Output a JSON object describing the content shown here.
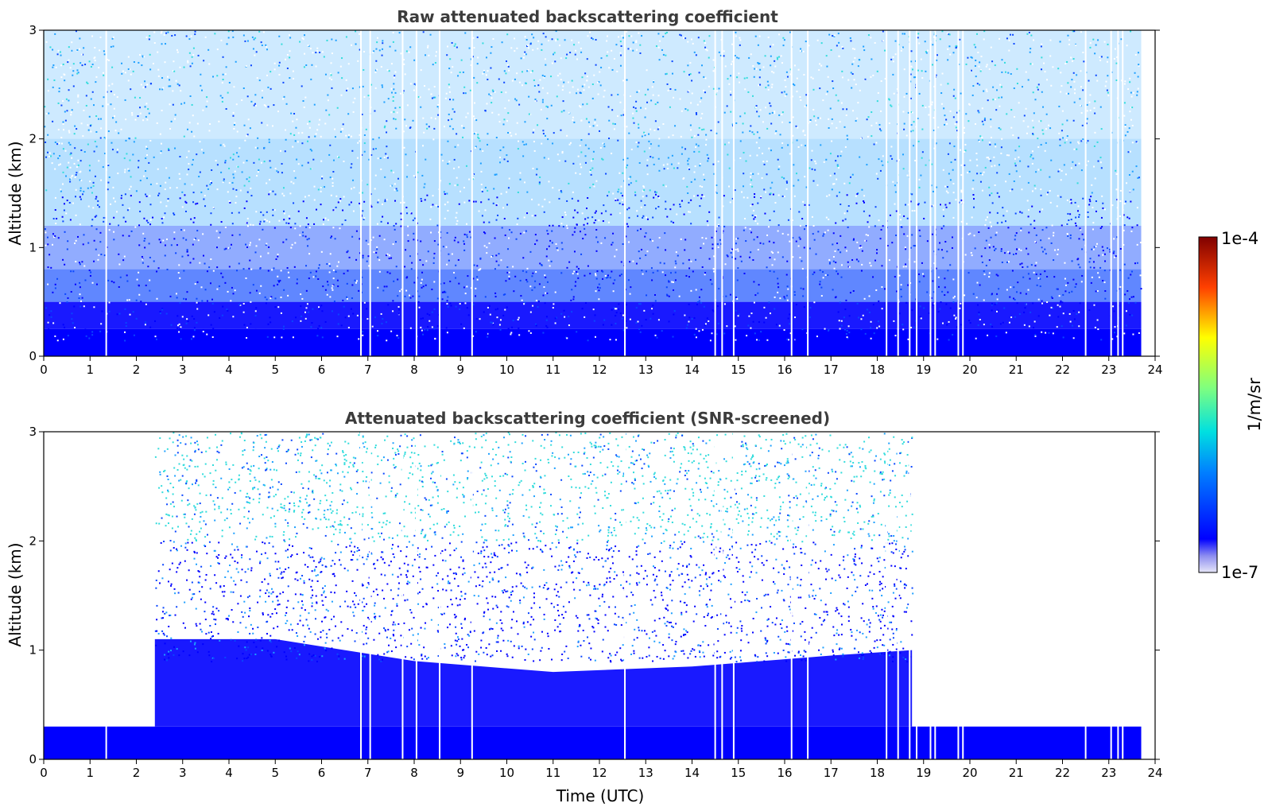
{
  "figure": {
    "colorbar": {
      "max_label": "1e-4",
      "min_label": "1e-7",
      "unit_label": "1/m/sr",
      "scale": "log",
      "colormap": "jet"
    }
  },
  "chart_data": [
    {
      "type": "heatmap",
      "title": "Raw attenuated backscattering coefficient",
      "xlabel": "",
      "ylabel": "Altitude (km)",
      "xlim": [
        0,
        24
      ],
      "ylim": [
        0,
        3
      ],
      "x_ticks": [
        "0",
        "1",
        "2",
        "3",
        "4",
        "5",
        "6",
        "7",
        "8",
        "9",
        "10",
        "11",
        "12",
        "13",
        "14",
        "15",
        "16",
        "17",
        "18",
        "19",
        "20",
        "21",
        "22",
        "23",
        "24"
      ],
      "y_ticks": [
        "0",
        "1",
        "2",
        "3"
      ],
      "data_coverage_hours": [
        0,
        23.7
      ],
      "colors": {
        "strong": "#0000ff",
        "mid": "#0a46ff",
        "weak": "#1ea0ff",
        "faint": "#32dcdc"
      },
      "gap_times_hours": [
        1.35,
        6.85,
        7.05,
        7.75,
        8.05,
        8.55,
        9.25,
        12.55,
        14.5,
        14.65,
        14.9,
        16.15,
        16.5,
        18.2,
        18.45,
        18.7,
        18.85,
        19.15,
        19.25,
        19.75,
        19.85,
        22.5,
        23.05,
        23.2,
        23.3
      ]
    },
    {
      "type": "heatmap",
      "title": "Attenuated backscattering coefficient (SNR-screened)",
      "xlabel": "Time (UTC)",
      "ylabel": "Altitude (km)",
      "xlim": [
        0,
        24
      ],
      "ylim": [
        0,
        3
      ],
      "x_ticks": [
        "0",
        "1",
        "2",
        "3",
        "4",
        "5",
        "6",
        "7",
        "8",
        "9",
        "10",
        "11",
        "12",
        "13",
        "14",
        "15",
        "16",
        "17",
        "18",
        "19",
        "20",
        "21",
        "22",
        "23",
        "24"
      ],
      "y_ticks": [
        "0",
        "1",
        "2",
        "3"
      ],
      "data_coverage_hours": [
        0,
        23.7
      ],
      "screened_window_hours": [
        2.4,
        18.75
      ],
      "surface_layer_top_km": 0.3,
      "colors": {
        "strong": "#0000ff",
        "mid": "#0a46ff",
        "weak": "#1ea0ff",
        "faint": "#32dcdc"
      },
      "gap_times_hours": [
        1.35,
        6.85,
        7.05,
        7.75,
        8.05,
        8.55,
        9.25,
        12.55,
        14.5,
        14.65,
        14.9,
        16.15,
        16.5,
        18.2,
        18.45,
        18.7,
        18.85,
        19.15,
        19.25,
        19.75,
        19.85,
        22.5,
        23.05,
        23.2,
        23.3
      ]
    }
  ]
}
